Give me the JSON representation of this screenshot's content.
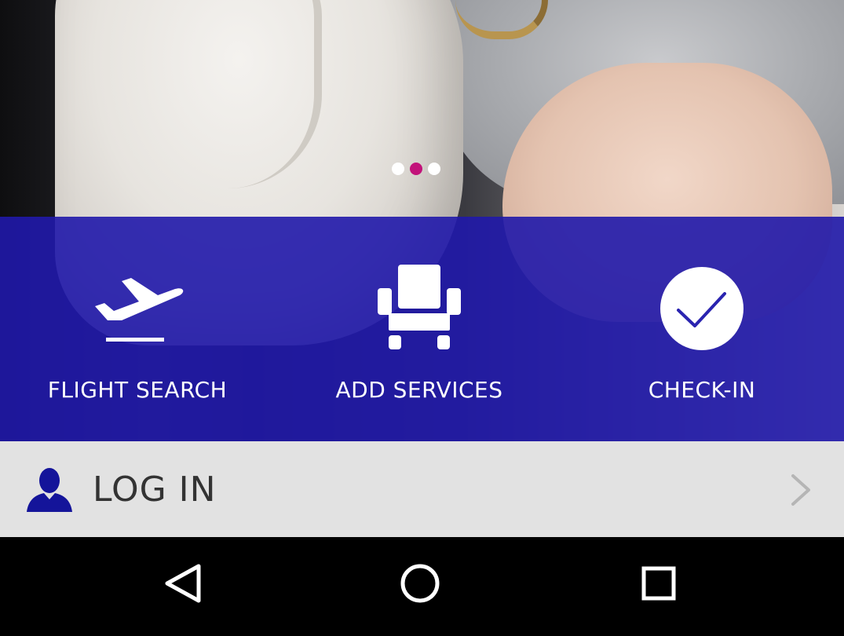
{
  "pager": {
    "total": 3,
    "active_index": 1,
    "active_color": "#c2127a",
    "inactive_color": "#ffffff"
  },
  "actions": [
    {
      "label": "FLIGHT SEARCH",
      "icon": "plane-takeoff-icon"
    },
    {
      "label": "ADD SERVICES",
      "icon": "seat-icon"
    },
    {
      "label": "CHECK-IN",
      "icon": "checkmark-circle-icon"
    }
  ],
  "login": {
    "label": "LOG IN",
    "icon": "user-icon",
    "chevron": "chevron-right-icon",
    "icon_color": "#14149a"
  },
  "navbar": {
    "back": "back-triangle-icon",
    "home": "home-circle-icon",
    "recents": "recents-square-icon"
  },
  "colors": {
    "overlay": "#2018aa",
    "login_bg": "#e2e2e2",
    "navbar_bg": "#000000"
  }
}
